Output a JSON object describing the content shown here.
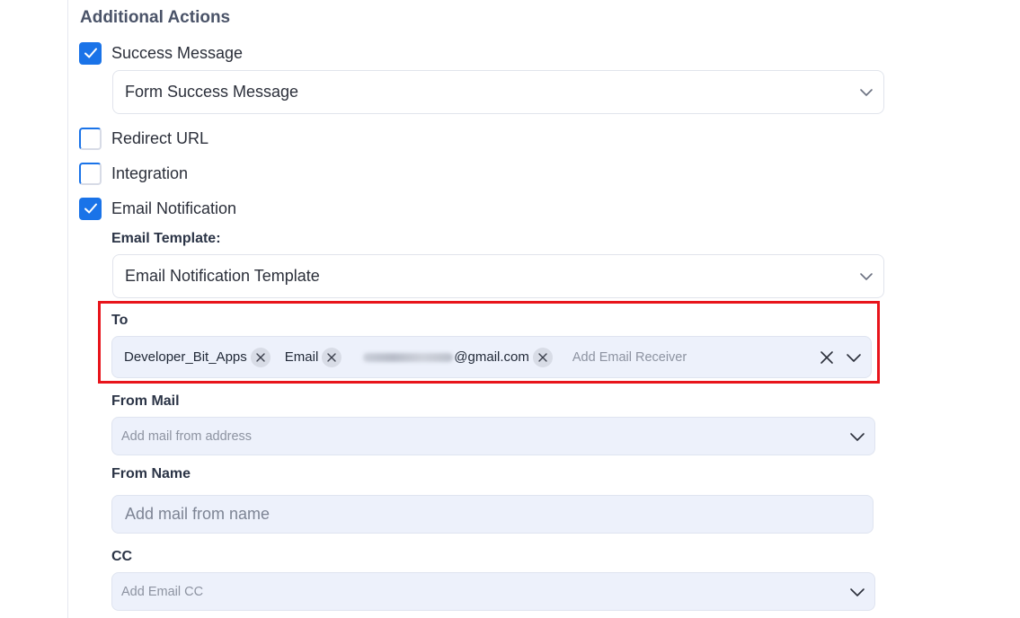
{
  "section": {
    "title": "Additional Actions"
  },
  "actions": {
    "success_message": {
      "label": "Success Message",
      "checked": true,
      "select_value": "Form Success Message"
    },
    "redirect_url": {
      "label": "Redirect URL",
      "checked": false
    },
    "integration": {
      "label": "Integration",
      "checked": false
    },
    "email_notification": {
      "label": "Email Notification",
      "checked": true
    }
  },
  "email": {
    "template_label": "Email Template:",
    "template_value": "Email Notification Template",
    "to_label": "To",
    "to_tags": [
      "Developer_Bit_Apps",
      "Email",
      "@gmail.com"
    ],
    "to_placeholder": "Add Email Receiver",
    "from_mail_label": "From Mail",
    "from_mail_placeholder": "Add mail from address",
    "from_name_label": "From Name",
    "from_name_placeholder": "Add mail from name",
    "cc_label": "CC",
    "cc_placeholder": "Add Email CC"
  },
  "colors": {
    "accent": "#1a73e8",
    "highlight": "#e8141b"
  }
}
